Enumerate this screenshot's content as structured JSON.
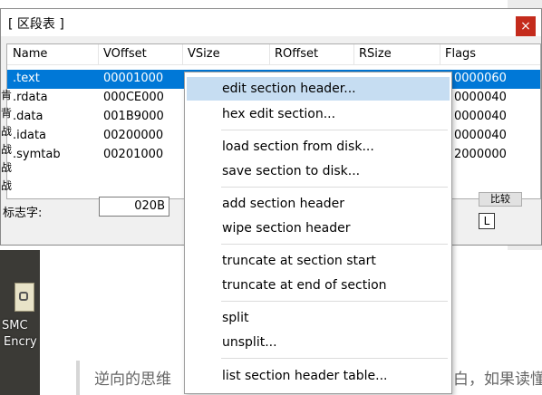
{
  "dialog": {
    "title": "[ 区段表 ]",
    "close_glyph": "×",
    "columns": [
      "Name",
      "VOffset",
      "VSize",
      "ROffset",
      "RSize",
      "Flags"
    ],
    "rows": [
      {
        "name": ".text",
        "voffset": "00001000",
        "flags": "0000060",
        "selected": true
      },
      {
        "name": ".rdata",
        "voffset": "000CE000",
        "flags": "0000040",
        "selected": false
      },
      {
        "name": ".data",
        "voffset": "001B9000",
        "flags": "0000040",
        "selected": false
      },
      {
        "name": ".idata",
        "voffset": "00200000",
        "flags": "0000040",
        "selected": false
      },
      {
        "name": ".symtab",
        "voffset": "00201000",
        "flags": "2000000",
        "selected": false
      }
    ],
    "flag_label": "标志字:",
    "flag_value": "020B",
    "right_button_label": "比较",
    "right_check_label": "L",
    "left_clipped_chars": [
      "肯",
      "背",
      "战",
      "战",
      "战",
      "战"
    ]
  },
  "context_menu": {
    "items": [
      "edit section header...",
      "hex edit section...",
      "load section from disk...",
      "save section to disk...",
      "add section header",
      "wipe section header",
      "truncate at section start",
      "truncate at end of section",
      "split",
      "unsplit...",
      "list section header table..."
    ],
    "highlighted_index": 0
  },
  "desktop": {
    "icon_name": "encrypted-file-icon",
    "label_line1": "SMC",
    "label_line2": "Encry"
  },
  "article": {
    "text_left": "逆向的思维",
    "text_right": "白，如果读懂"
  },
  "colors": {
    "selection": "#0078d7",
    "menu_highlight": "#c6ddf2",
    "close_button": "#c42b1c"
  }
}
